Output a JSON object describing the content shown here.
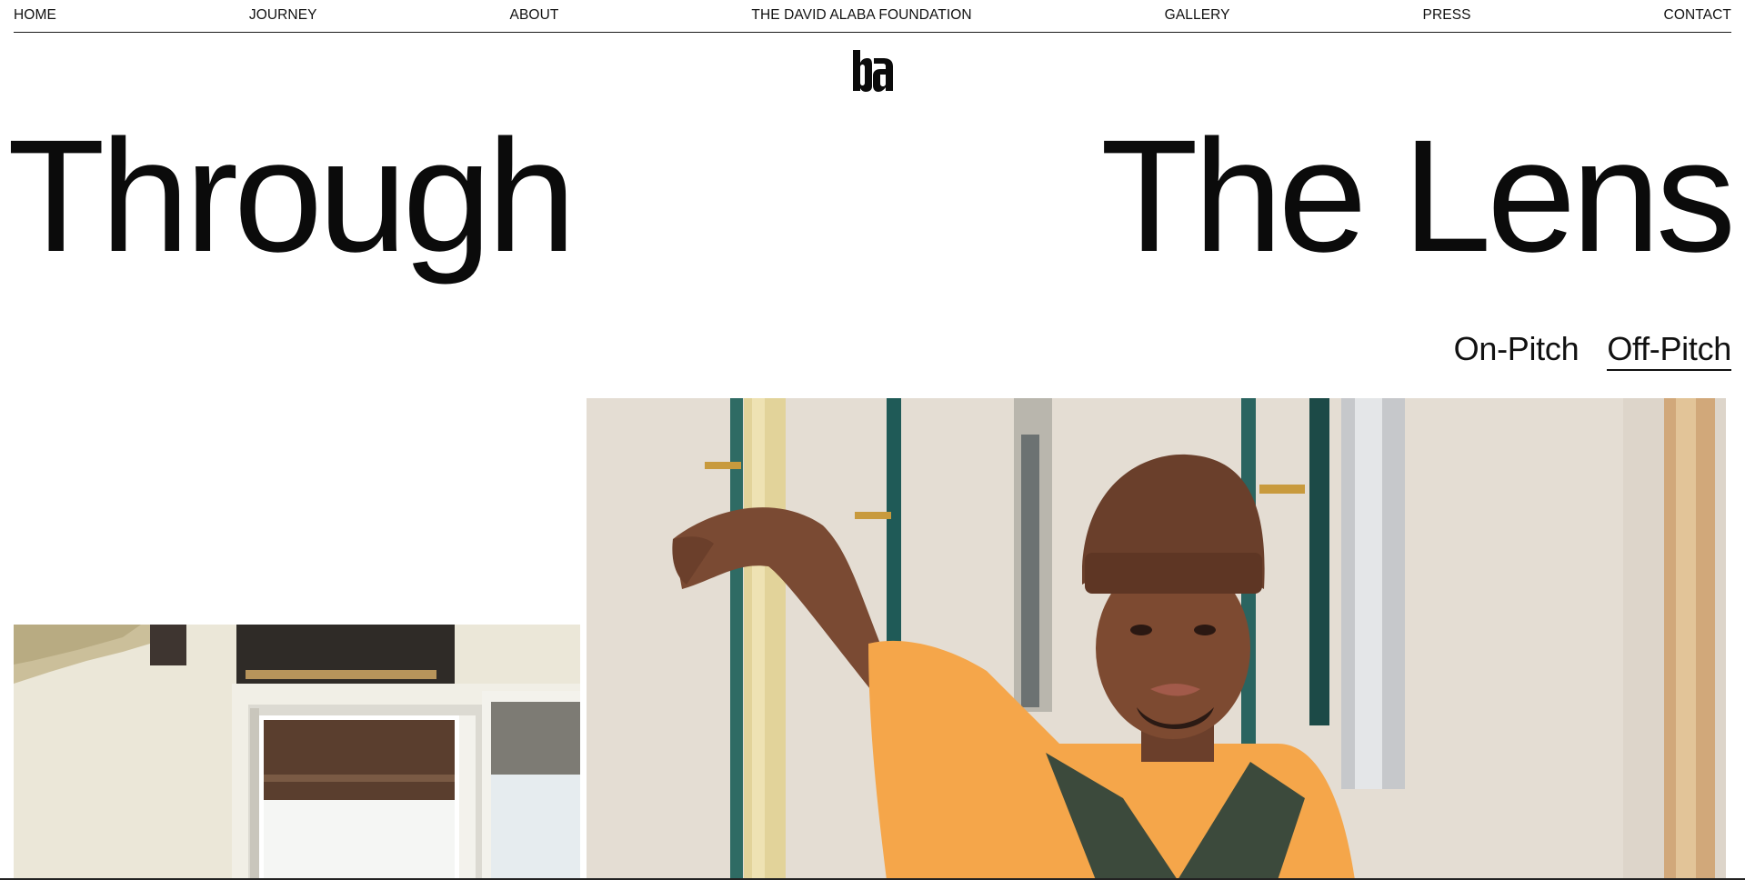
{
  "nav": {
    "items": [
      {
        "label": "HOME"
      },
      {
        "label": "JOURNEY"
      },
      {
        "label": "ABOUT"
      },
      {
        "label": "THE DAVID ALABA FOUNDATION"
      },
      {
        "label": "GALLERY"
      },
      {
        "label": "PRESS"
      },
      {
        "label": "CONTACT"
      }
    ]
  },
  "logo": {
    "text": "DA",
    "icon": "da-monogram-logo"
  },
  "hero": {
    "left": "Through",
    "right": "The Lens"
  },
  "filters": [
    {
      "label": "On-Pitch",
      "active": false
    },
    {
      "label": "Off-Pitch",
      "active": true
    }
  ],
  "gallery": {
    "photos": [
      {
        "name": "interior-window-photo"
      },
      {
        "name": "portrait-beanie-photo"
      }
    ]
  },
  "colors": {
    "background": "#ffffff",
    "text": "#0d0d0d",
    "shirt": "#f5a64a",
    "overalls": "#3c4a3c",
    "beanie": "#6a3f2b"
  }
}
